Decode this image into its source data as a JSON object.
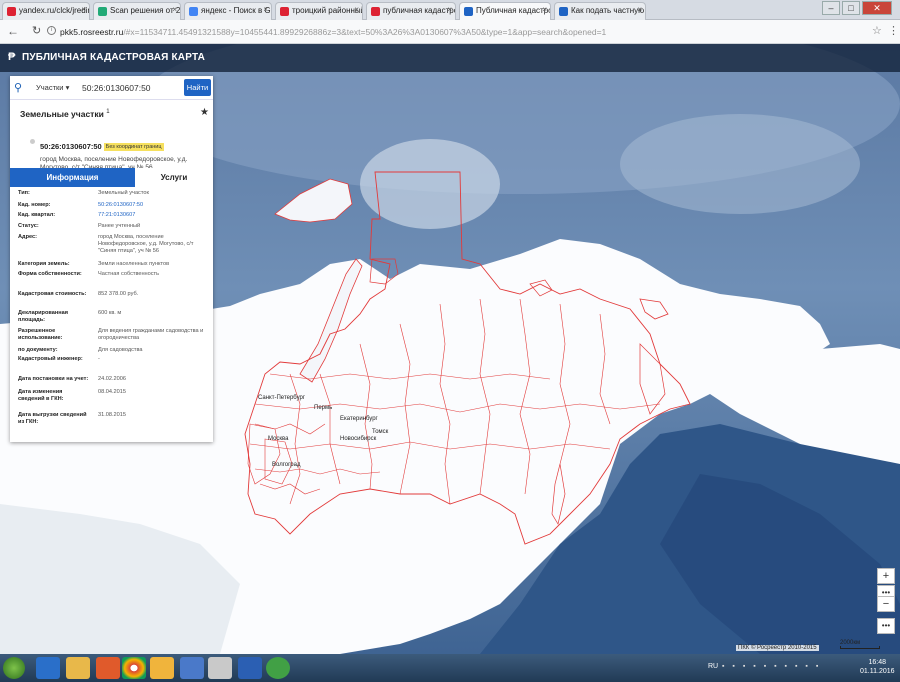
{
  "browser": {
    "tabs": [
      {
        "label": "yandex.ru/clck/jredir?",
        "color": "#d23"
      },
      {
        "label": "Scan решения от 26.07",
        "color": "#2a7"
      },
      {
        "label": "яндекс - Поиск в Goog",
        "color": "#4285f4"
      },
      {
        "label": "троицкий районный су",
        "color": "#d23"
      },
      {
        "label": "публичная кадастрова",
        "color": "#d23"
      },
      {
        "label": "Публичная кадастрова",
        "color": "#1f64c4"
      },
      {
        "label": "Как подать частную жа",
        "color": "#1f64c4"
      }
    ],
    "url_host": "pkk5.rosreestr.ru",
    "url_rest": "/#x=11534711.45491321588y=10455441.8992926886z=3&text=50%3A26%3A0130607%3A50&type=1&app=search&opened=1"
  },
  "app": {
    "title": "ПУБЛИЧНАЯ КАДАСТРОВАЯ КАРТА"
  },
  "search": {
    "filter_label": "Участки",
    "query": "50:26:0130607:50",
    "button_label": "Найти"
  },
  "panel": {
    "section_title": "Земельные участки",
    "section_count": "1",
    "parcel_number": "50:26:0130607:50",
    "parcel_badge": "Без координат границ",
    "parcel_address": "город Москва, поселение Новофедоровское, у.д. Могутово, с/т \"Синяя птица\", уч № 56",
    "tab_info": "Информация",
    "tab_services": "Услуги",
    "properties": [
      {
        "key": "Тип:",
        "value": "Земельный участок",
        "link": false
      },
      {
        "key": "Кад. номер:",
        "value": "50:26:0130607:50",
        "link": true
      },
      {
        "key": "Кад. квартал:",
        "value": "77:21:0130607",
        "link": true
      },
      {
        "key": "Статус:",
        "value": "Ранее учтенный",
        "link": false
      },
      {
        "key": "Адрес:",
        "value": "город Москва, поселение Новофедоровское, у.д. Могутово, с/т \"Синяя птица\", уч № 56",
        "link": false
      },
      {
        "key": "Категория земель:",
        "value": "Земли населенных пунктов",
        "link": false
      },
      {
        "key": "Форма собственности:",
        "value": "Частная собственность",
        "link": false
      },
      {
        "key": "Кадастровая стоимость:",
        "value": "852 378.00 руб.",
        "link": false
      },
      {
        "key": "Декларированная площадь:",
        "value": "600 кв. м",
        "link": false
      },
      {
        "key": "Разрешенное использование:",
        "value": "Для ведения гражданами садоводства и огородничества",
        "link": false
      },
      {
        "key": "по документу:",
        "value": "Для садоводства",
        "link": false
      },
      {
        "key": "Кадастровый инженер:",
        "value": "-",
        "link": false
      },
      {
        "key": "Дата постановки на учет:",
        "value": "24.02.2006",
        "link": false
      },
      {
        "key": "Дата изменения сведений в ГКН:",
        "value": "08.04.2015",
        "link": false
      },
      {
        "key": "Дата выгрузки сведений из ГКН:",
        "value": "31.08.2015",
        "link": false
      }
    ]
  },
  "map": {
    "cities": [
      "Санкт-Петербург",
      "Пермь",
      "Екатеринбург",
      "Томск",
      "Новосибирск",
      "Москва",
      "Волгоград"
    ],
    "copyright": "ПКК © Росреестр 2010-2015",
    "scale": "2000км",
    "zoom_in": "+",
    "zoom_out": "−"
  },
  "taskbar": {
    "lang": "RU",
    "time": "16:48",
    "date": "01.11.2016"
  }
}
